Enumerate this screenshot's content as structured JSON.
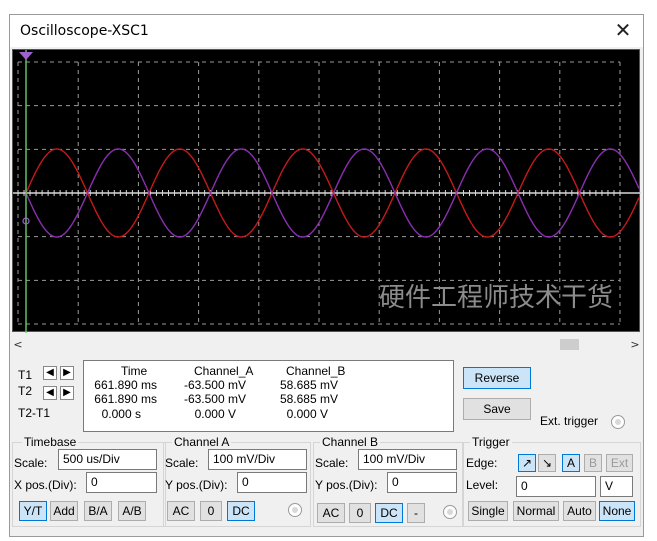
{
  "window": {
    "title": "Oscilloscope-XSC1",
    "close_glyph": "✕"
  },
  "screen": {
    "background": "#000000",
    "grid_color": "#9a9a9a",
    "channel_a_color": "#c41a1a",
    "channel_b_color": "#8a2fb0",
    "cursor_t1_color": "#6acd6a",
    "watermark": "硬件工程师技术干货"
  },
  "scrollbar": {
    "left_glyph": "<",
    "right_glyph": ">"
  },
  "cursors": {
    "t1_label": "T1",
    "t2_label": "T2",
    "diff_label": "T2-T1",
    "left_arrow": "◀",
    "right_arrow": "▶"
  },
  "readout": {
    "headers": [
      "Time",
      "Channel_A",
      "Channel_B"
    ],
    "rows": [
      [
        "661.890 ms",
        "-63.500 mV",
        "58.685 mV"
      ],
      [
        "661.890 ms",
        "-63.500 mV",
        "58.685 mV"
      ],
      [
        "0.000 s",
        "0.000 V",
        "0.000 V"
      ]
    ]
  },
  "actions": {
    "reverse": "Reverse",
    "save": "Save",
    "ext_trigger": "Ext. trigger"
  },
  "timebase": {
    "title": "Timebase",
    "scale_label": "Scale:",
    "scale_value": "500 us/Div",
    "pos_label": "X pos.(Div):",
    "pos_value": "0",
    "modes": [
      "Y/T",
      "Add",
      "B/A",
      "A/B"
    ],
    "selected_mode": "Y/T"
  },
  "channel_a": {
    "title": "Channel A",
    "scale_label": "Scale:",
    "scale_value": "100 mV/Div",
    "pos_label": "Y pos.(Div):",
    "pos_value": "0",
    "coupling": [
      "AC",
      "0",
      "DC"
    ],
    "selected_coupling": "DC"
  },
  "channel_b": {
    "title": "Channel B",
    "scale_label": "Scale:",
    "scale_value": "100 mV/Div",
    "pos_label": "Y pos.(Div):",
    "pos_value": "0",
    "coupling": [
      "AC",
      "0",
      "DC",
      "-"
    ],
    "selected_coupling": "DC"
  },
  "trigger": {
    "title": "Trigger",
    "edge_label": "Edge:",
    "edge_rising": "↗",
    "edge_falling": "↘",
    "sources": [
      "A",
      "B",
      "Ext"
    ],
    "selected_source": "A",
    "level_label": "Level:",
    "level_value": "0",
    "level_unit": "V",
    "modes": [
      "Single",
      "Normal",
      "Auto",
      "None"
    ],
    "selected_mode": "None"
  }
}
